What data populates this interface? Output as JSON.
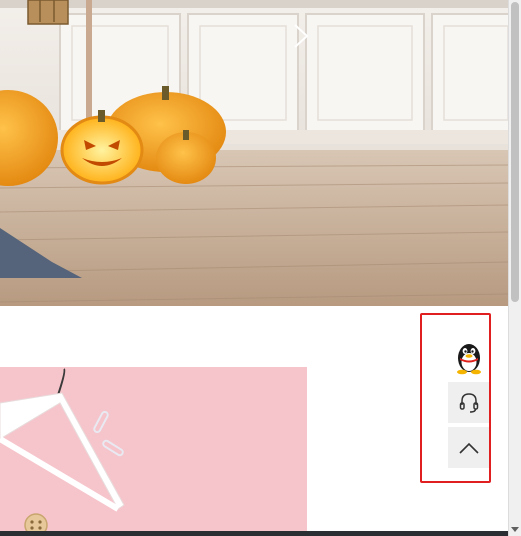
{
  "banner": {
    "image": "halloween-pumpkins-living-room",
    "nav_next": "chevron-right-icon"
  },
  "promo": {
    "image": "white-hanger-on-pink-background"
  },
  "side_widget": {
    "highlight_color": "#e02020",
    "buttons": [
      {
        "id": "qq",
        "icon": "qq-penguin-icon"
      },
      {
        "id": "service",
        "icon": "headset-icon"
      },
      {
        "id": "back_to_top",
        "icon": "chevron-up-icon"
      }
    ]
  }
}
